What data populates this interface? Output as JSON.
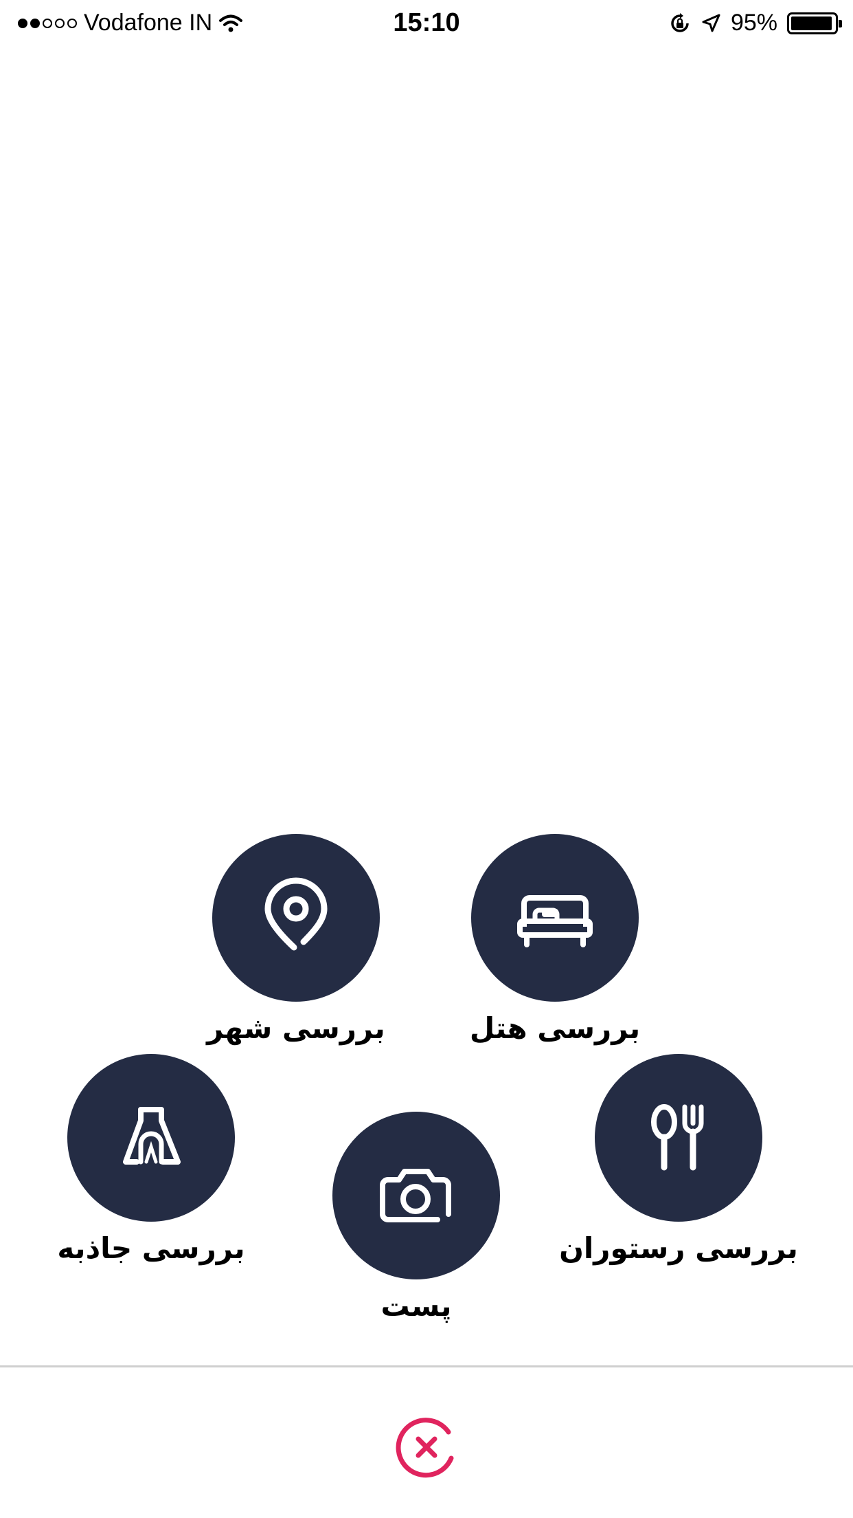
{
  "status_bar": {
    "carrier": "Vodafone IN",
    "time": "15:10",
    "battery_percent": "95%",
    "battery_level": 0.95,
    "signal_bars_filled": 2,
    "signal_bars_total": 5,
    "icons": [
      "wifi-icon",
      "rotation-lock-icon",
      "location-arrow-icon",
      "battery-icon"
    ]
  },
  "menu": {
    "city_review": {
      "label": "بررسی شهر",
      "icon": "map-pin-icon"
    },
    "hotel_review": {
      "label": "بررسی هتل",
      "icon": "bed-icon"
    },
    "attraction_review": {
      "label": "بررسی جاذبه",
      "icon": "monument-icon"
    },
    "post": {
      "label": "پست",
      "icon": "camera-icon"
    },
    "restaurant_review": {
      "label": "بررسی رستوران",
      "icon": "fork-spoon-icon"
    }
  },
  "close": {
    "icon": "close-icon"
  },
  "colors": {
    "button_bg": "#242c44",
    "icon_fg": "#ffffff",
    "close_accent": "#e0245e",
    "divider": "#cfcfcf"
  }
}
